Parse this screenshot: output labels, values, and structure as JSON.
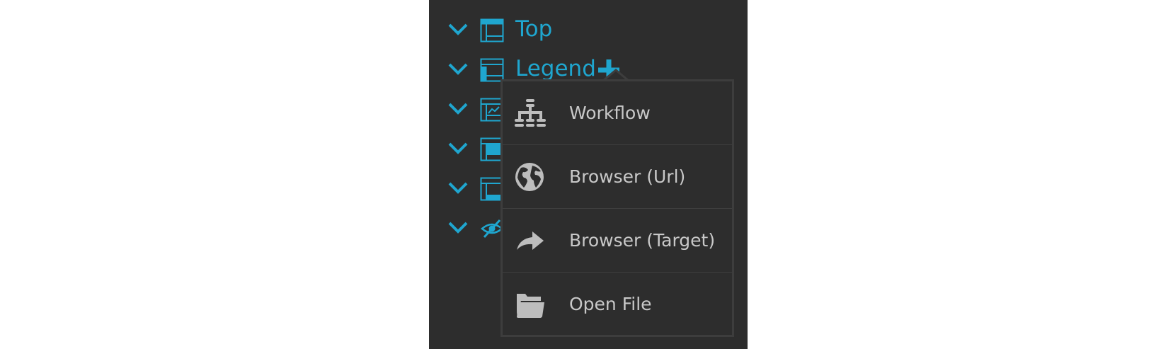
{
  "tree": {
    "items": [
      {
        "label": "Top",
        "icon": "layout-top-icon"
      },
      {
        "label": "Legend",
        "icon": "layout-legend-icon"
      },
      {
        "label": "",
        "icon": "layout-chart-icon"
      },
      {
        "label": "",
        "icon": "layout-filled-left-icon"
      },
      {
        "label": "",
        "icon": "layout-bottom-icon"
      },
      {
        "label": "",
        "icon": "hidden-eye-icon"
      }
    ],
    "add_icon": "plus-icon"
  },
  "menu": {
    "items": [
      {
        "label": "Workflow",
        "icon": "workflow-sitemap-icon"
      },
      {
        "label": "Browser (Url)",
        "icon": "globe-icon"
      },
      {
        "label": "Browser (Target)",
        "icon": "share-arrow-icon"
      },
      {
        "label": "Open File",
        "icon": "folder-open-icon"
      }
    ]
  },
  "colors": {
    "panel_bg": "#2d2d2d",
    "accent": "#1fa6cf",
    "menu_text": "#c8c8c8",
    "menu_icon": "#bdbdbd",
    "menu_border": "#3d3d3d"
  }
}
